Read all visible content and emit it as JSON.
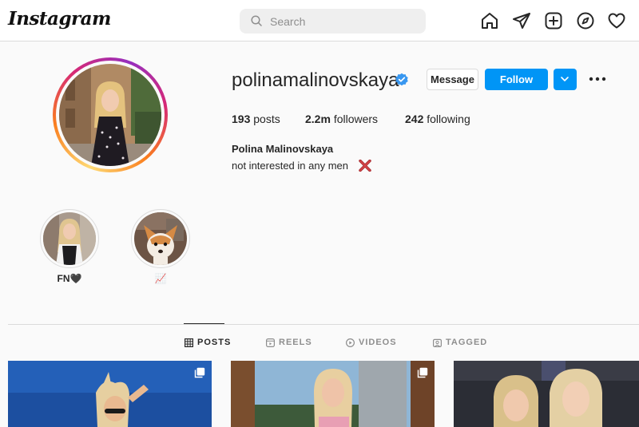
{
  "nav": {
    "logo_text": "Instagram",
    "search_placeholder": "Search",
    "icons": [
      "home-icon",
      "direct-icon",
      "new-post-icon",
      "explore-icon",
      "activity-icon"
    ]
  },
  "profile": {
    "username": "polinamalinovskaya",
    "verified": true,
    "message_label": "Message",
    "follow_label": "Follow",
    "stats": {
      "posts_count": "193",
      "posts_label": "posts",
      "followers_count": "2.2m",
      "followers_label": "followers",
      "following_count": "242",
      "following_label": "following"
    },
    "full_name": "Polina Malinovskaya",
    "bio": "not interested in any men"
  },
  "highlights": [
    {
      "label": "FN🖤"
    },
    {
      "label": "📈"
    }
  ],
  "tabs": [
    {
      "label": "POSTS",
      "icon": "grid-icon",
      "active": true
    },
    {
      "label": "REELS",
      "icon": "reels-icon",
      "active": false
    },
    {
      "label": "VIDEOS",
      "icon": "video-icon",
      "active": false
    },
    {
      "label": "TAGGED",
      "icon": "tagged-icon",
      "active": false
    }
  ],
  "colors": {
    "follow_blue": "#0095f6",
    "verified_blue": "#3897f0",
    "text": "#262626",
    "muted": "#8e8e8e",
    "border": "#dbdbdb"
  }
}
